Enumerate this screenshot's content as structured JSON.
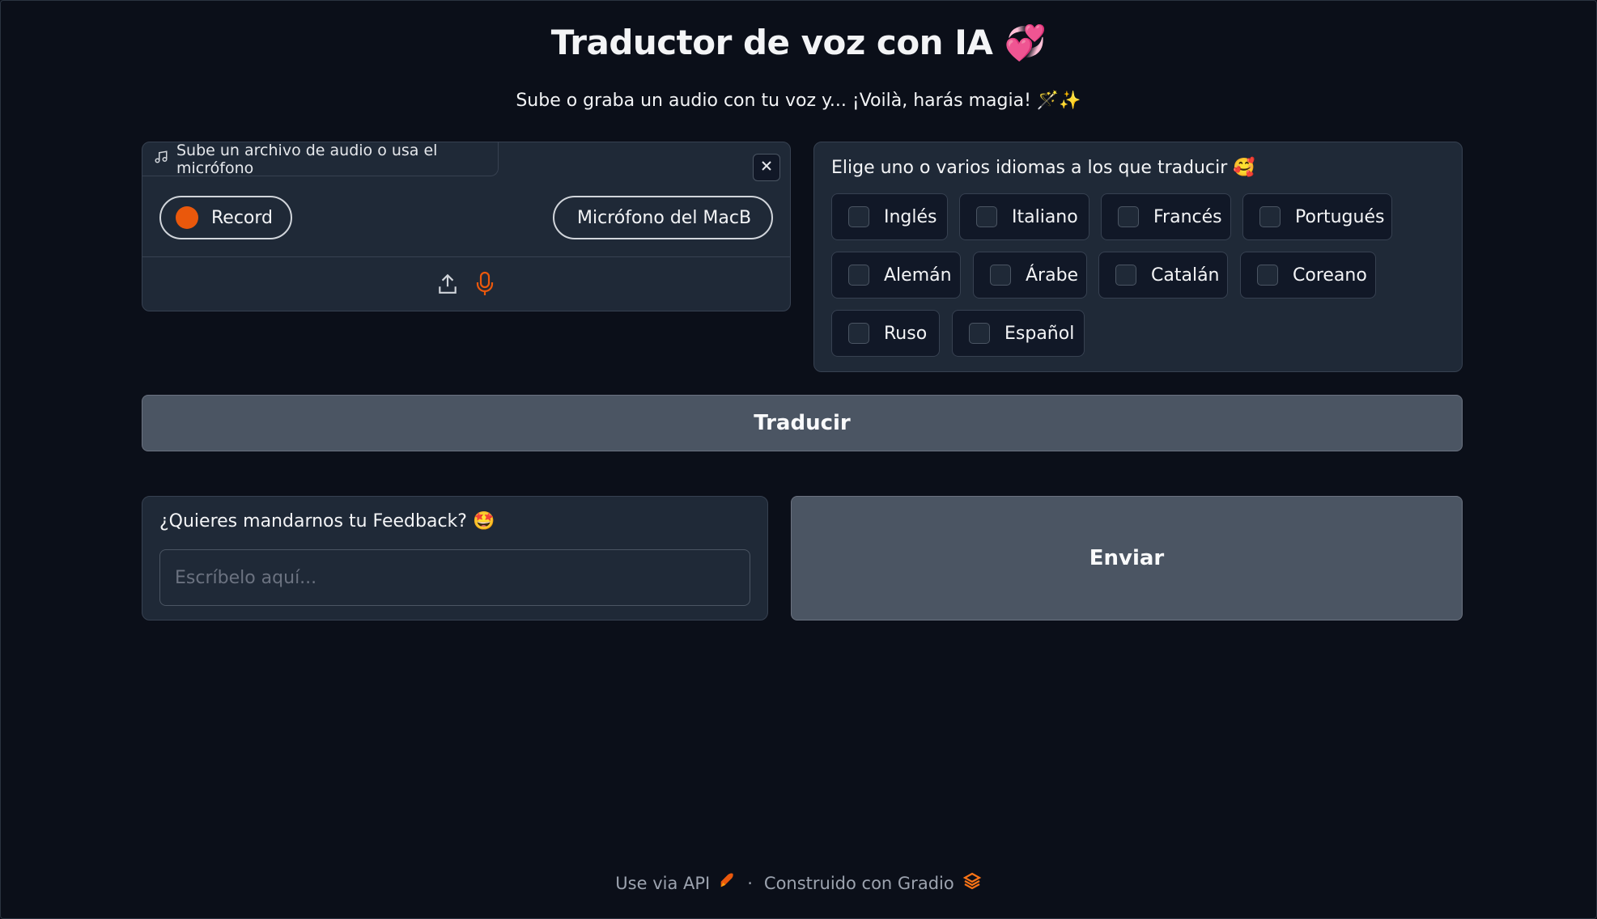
{
  "header": {
    "title": "Traductor de voz con IA 💞",
    "subtitle": "Sube o graba un audio con tu voz y... ¡Voilà, harás magia! 🪄✨"
  },
  "audio": {
    "label": "Sube un archivo de audio o usa el micrófono",
    "record_label": "Record",
    "microphone_value": "Micrófono del MacBook",
    "icons": [
      "music-note-icon",
      "close-icon",
      "upload-icon",
      "microphone-icon"
    ]
  },
  "languages": {
    "label": "Elige uno o varios idiomas a los que traducir 🥰",
    "options": [
      "Inglés",
      "Italiano",
      "Francés",
      "Portugués",
      "Alemán",
      "Árabe",
      "Catalán",
      "Coreano",
      "Ruso",
      "Español"
    ]
  },
  "translate_button": "Traducir",
  "feedback": {
    "label": "¿Quieres mandarnos tu Feedback? 🤩",
    "placeholder": "Escríbelo aquí...",
    "value": ""
  },
  "send_button": "Enviar",
  "footer": {
    "api_label": "Use via API",
    "separator": "·",
    "built_with": "Construido con Gradio"
  },
  "colors": {
    "background": "#0b0f19",
    "panel": "#1f2937",
    "accent": "#ea580c",
    "button": "#4b5563"
  }
}
